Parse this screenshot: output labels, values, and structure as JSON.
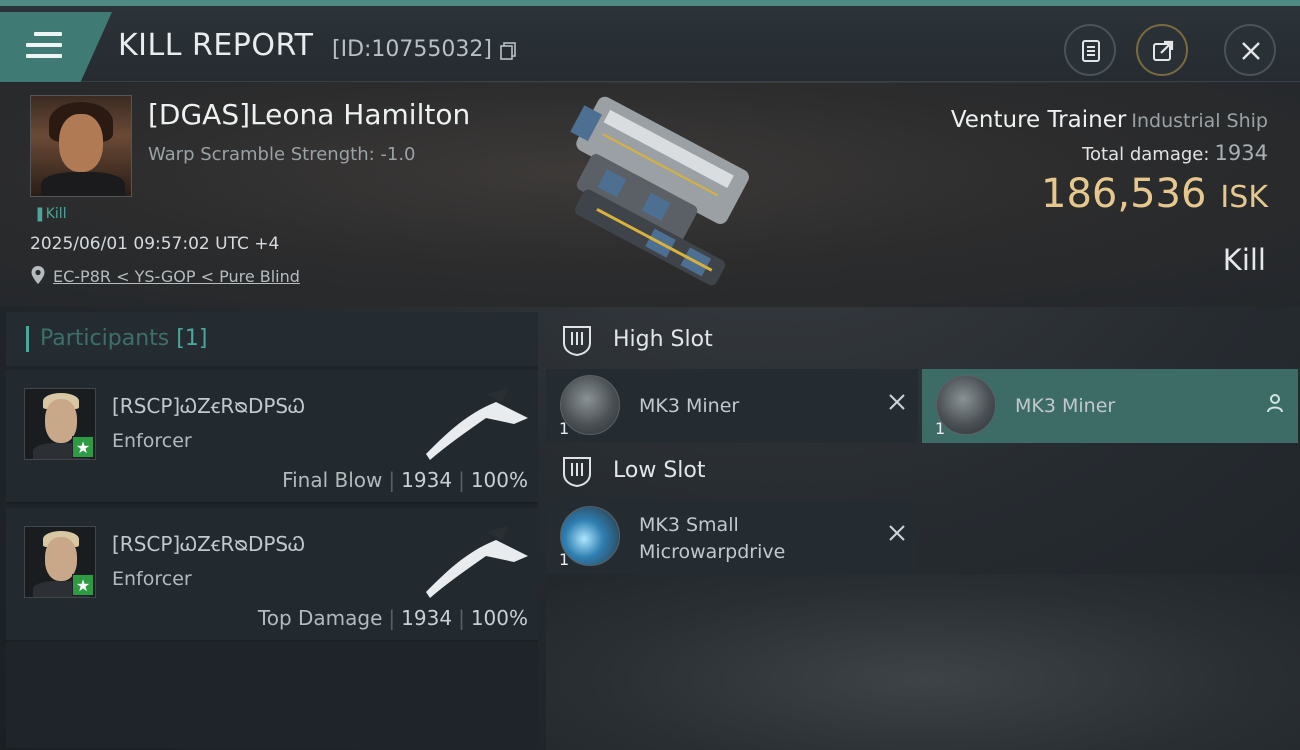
{
  "header": {
    "title": "KILL REPORT",
    "report_id": "[ID:10755032]"
  },
  "victim": {
    "name": "[DGAS]Leona Hamilton",
    "warp_scramble": "Warp Scramble Strength: -1.0",
    "kill_tag": "Kill",
    "datetime": "2025/06/01 09:57:02 UTC +4",
    "location": "EC-P8R < YS-GOP < Pure Blind",
    "ship_name": "Venture Trainer",
    "ship_class": "Industrial Ship",
    "total_damage_label": "Total damage:",
    "total_damage": "1934",
    "isk_value": "186,536",
    "isk_unit": "ISK",
    "status": "Kill"
  },
  "participants": {
    "label": "Participants",
    "count": "[1]",
    "items": [
      {
        "name": "[RSCP]ᏇZꞓRᴓDPSᏇ",
        "ship": "Enforcer",
        "role": "Final Blow",
        "damage": "1934",
        "percent": "100%"
      },
      {
        "name": "[RSCP]ᏇZꞓRᴓDPSᏇ",
        "ship": "Enforcer",
        "role": "Top Damage",
        "damage": "1934",
        "percent": "100%"
      }
    ]
  },
  "slots": {
    "high": {
      "label": "High Slot",
      "modules": [
        {
          "name": "MK3 Miner",
          "qty": "1",
          "state": "destroyed"
        },
        {
          "name": "MK3 Miner",
          "qty": "1",
          "state": "dropped"
        }
      ]
    },
    "low": {
      "label": "Low Slot",
      "modules": [
        {
          "name": "MK3 Small Microwarpdrive",
          "name_line1": "MK3 Small",
          "name_line2": "Microwarpdrive",
          "qty": "1",
          "state": "destroyed"
        }
      ]
    }
  },
  "colors": {
    "accent": "#4aa79b",
    "isk": "#e6c88f",
    "dropped_highlight": "#3d6c67",
    "badge": "#2f9a44"
  },
  "icons": [
    "menu-icon",
    "copy-icon",
    "clipboard-icon",
    "share-icon",
    "close-icon",
    "location-pin-icon",
    "slot-icon",
    "destroyed-x-icon",
    "person-icon",
    "star-icon"
  ]
}
